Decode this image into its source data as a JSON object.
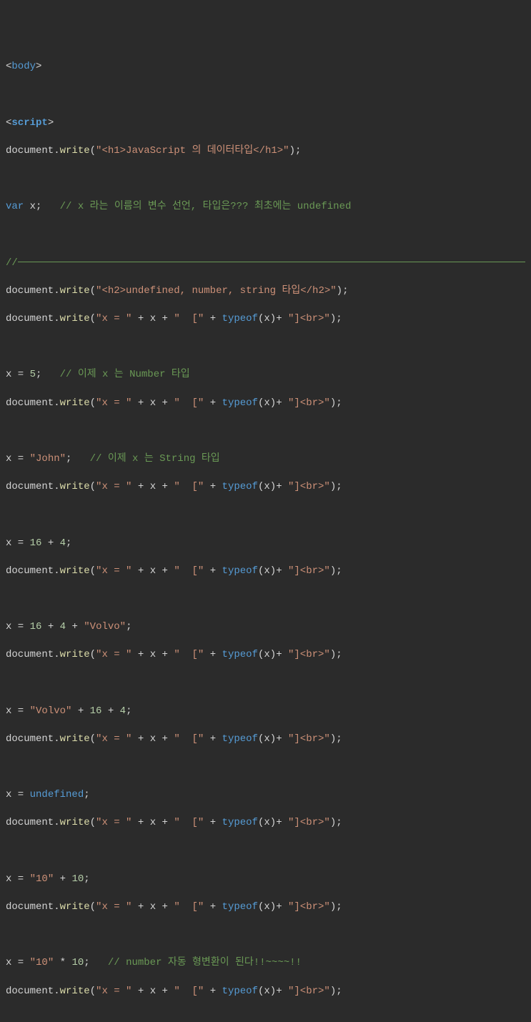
{
  "lines": {
    "l1_tag": "body",
    "l3_tag": "script",
    "l4_obj": "document",
    "l4_method": "write",
    "l4_str": "\"<h1>JavaScript 의 데이터타입</h1>\"",
    "l6_kw": "var",
    "l6_var": " x;",
    "l6_comment": "// x 라는 이름의 변수 선언, 타입은??? 최초에는 undefined",
    "l8_hr_prefix": "//",
    "l9_str": "\"<h2>undefined, number, string 타입</h2>\"",
    "dw_obj": "document",
    "dw_method": "write",
    "dw_s1": "\"x = \"",
    "dw_plus": " + ",
    "dw_x": "x",
    "dw_s2": "\"  [\"",
    "dw_typeof": "typeof",
    "dw_s3": "\"]<br>\"",
    "l12_assign": "x = ",
    "l12_num": "5",
    "l12_comment": "// 이제 x 는 Number 타입",
    "l15_assign": "x = ",
    "l15_str": "\"John\"",
    "l15_comment": "// 이제 x 는 String 타입",
    "l18_assign": "x = ",
    "l18_n1": "16",
    "l18_n2": "4",
    "l21_assign": "x = ",
    "l21_n1": "16",
    "l21_n2": "4",
    "l21_str": "\"Volvo\"",
    "l24_assign": "x = ",
    "l24_str": "\"Volvo\"",
    "l24_n1": "16",
    "l24_n2": "4",
    "l27_assign": "x = ",
    "l27_undef": "undefined",
    "l30_assign": "x = ",
    "l30_str": "\"10\"",
    "l30_n1": "10",
    "l33_assign": "x = ",
    "l33_str": "\"10\"",
    "l33_n1": "10",
    "l33_comment": "// number 자동 형변환이 된다!!~~~~!!"
  }
}
